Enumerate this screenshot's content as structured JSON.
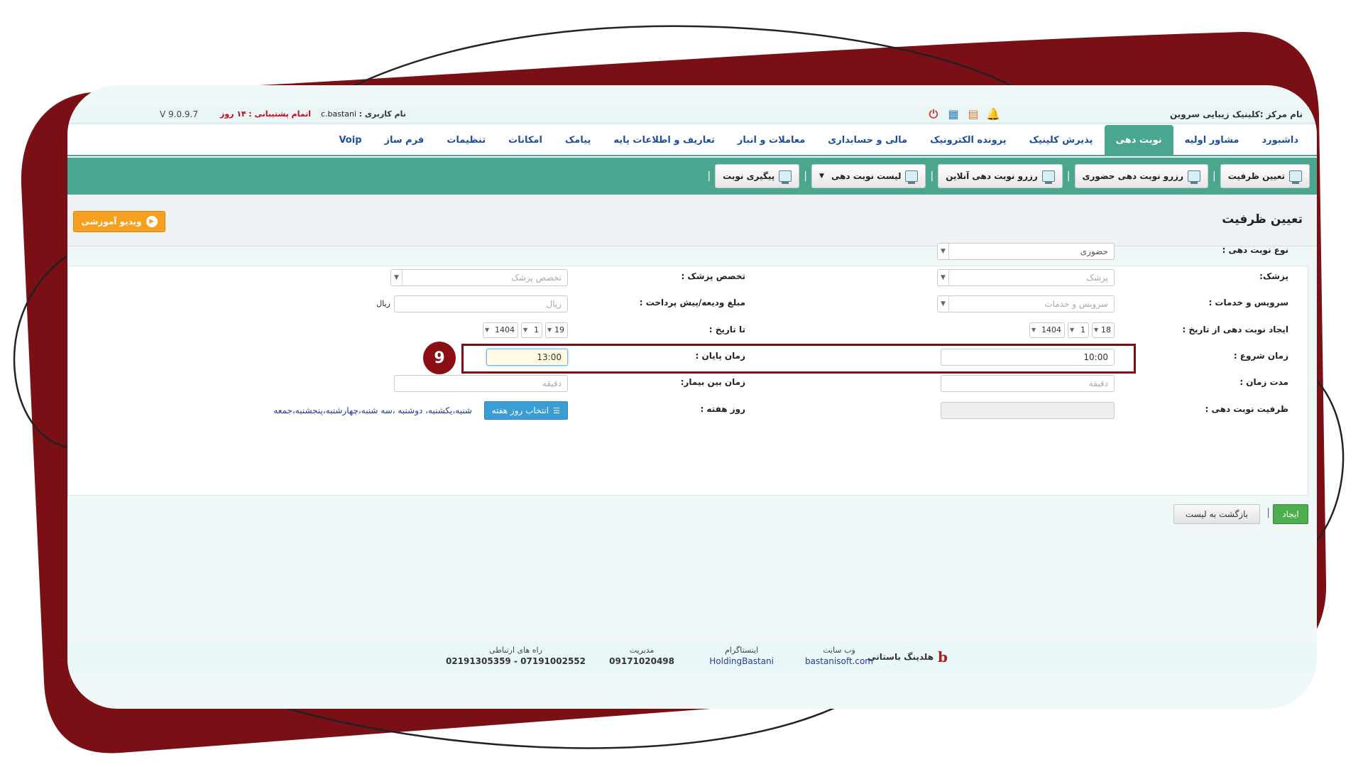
{
  "colors": {
    "frame": "#7a0f15",
    "accent_green": "#4aa68f",
    "link_blue": "#1c4e9e",
    "video_orange": "#f5a11f",
    "create_green": "#4cae4c",
    "weekday_blue": "#3a9ed4"
  },
  "topbar": {
    "center_name": "نام مرکز :کلینیک زیبایی سروین",
    "user_label": "نام کاربری :",
    "user_value": "c.bastani",
    "support_label": "اتمام پشتیبانی :",
    "support_value": "۱۴ روز",
    "version": "V 9.0.9.7",
    "icons": [
      "bell-icon",
      "grid-icon",
      "calendar-icon",
      "power-icon"
    ]
  },
  "nav": {
    "tabs": [
      "داشبورد",
      "مشاور اولیه",
      "نوبت دهی",
      "پذیرش کلینیک",
      "پرونده الکترونیک",
      "مالی و حسابداری",
      "معاملات و انبار",
      "تعاریف و اطلاعات پایه",
      "پیامک",
      "امکانات",
      "تنظیمات",
      "فرم ساز",
      "Voip"
    ],
    "active_index": 2
  },
  "toolbar": {
    "buttons": [
      "تعیین ظرفیت",
      "رزرو نوبت دهی حضوری",
      "رزرو نوبت دهی آنلاین",
      "لیست نوبت دهی",
      "پیگیری نوبت"
    ]
  },
  "page": {
    "title": "تعیین ظرفیت",
    "video_label": "ویدیو آموزشی"
  },
  "form": {
    "appointment_type_label": "نوع نوبت دهی :",
    "appointment_type_value": "حضوری",
    "doctor_label": "پزشک:",
    "doctor_placeholder": "پزشک",
    "specialty_label": "تخصص پزشک :",
    "specialty_placeholder": "تخصص پزشک",
    "services_label": "سرویس و خدمات :",
    "services_placeholder": "سرویس و خدمات",
    "deposit_label": "مبلغ ودیعه/پیش پرداخت :",
    "deposit_placeholder": "ریال",
    "deposit_unit": "ریال",
    "from_date_label": "ایجاد نوبت دهی از تاریخ :",
    "from_date": {
      "day": "18",
      "month": "1",
      "year": "1404"
    },
    "to_date_label": "تا تاریخ :",
    "to_date": {
      "day": "19",
      "month": "1",
      "year": "1404"
    },
    "start_time_label": "زمان شروع :",
    "start_time_value": "10:00",
    "end_time_label": "زمان پایان :",
    "end_time_value": "13:00",
    "duration_label": "مدت زمان :",
    "duration_placeholder": "دقیقه",
    "gap_label": "زمان بین بیمار:",
    "gap_placeholder": "دقیقه",
    "capacity_label": "ظرفیت نوبت دهی :",
    "weekday_label": "روز هفته :",
    "weekday_button": "انتخاب روز هفته",
    "weekday_text": "شنبه،یکشنبه، دوشنبه ،سه شنبه،چهارشنبه،پنجشنبه،جمعه",
    "step_badge": "9"
  },
  "actions": {
    "create": "ایجاد",
    "back": "بازگشت به لیست"
  },
  "footer": {
    "brand_name": "هلدینگ باستانی",
    "brand_logo": "b",
    "website_head": "وب سایت",
    "website_value": "bastanisoft.com",
    "instagram_head": "اینستاگرام",
    "instagram_value": "HoldingBastani",
    "management_head": "مدیریت",
    "management_value": "09171020498",
    "contact_head": "راه های ارتباطی",
    "contact_value": "07191002552 - 02191305359"
  }
}
